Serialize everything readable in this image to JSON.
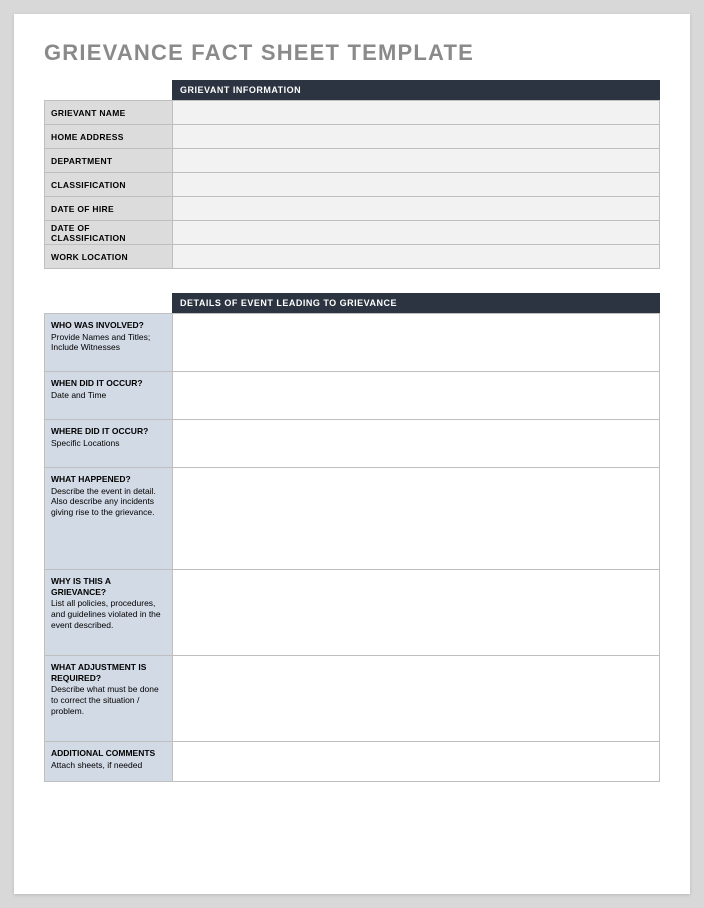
{
  "title": "GRIEVANCE FACT SHEET TEMPLATE",
  "section1": {
    "header": "GRIEVANT INFORMATION",
    "rows": [
      {
        "label": "GRIEVANT NAME",
        "value": ""
      },
      {
        "label": "HOME ADDRESS",
        "value": ""
      },
      {
        "label": "DEPARTMENT",
        "value": ""
      },
      {
        "label": "CLASSIFICATION",
        "value": ""
      },
      {
        "label": "DATE OF HIRE",
        "value": ""
      },
      {
        "label": "DATE OF CLASSIFICATION",
        "value": ""
      },
      {
        "label": "WORK LOCATION",
        "value": ""
      }
    ]
  },
  "section2": {
    "header": "DETAILS OF EVENT LEADING TO GRIEVANCE",
    "rows": [
      {
        "q": "WHO WAS INVOLVED?",
        "sub": "Provide Names and Titles; Include Witnesses",
        "size": "h-who",
        "value": ""
      },
      {
        "q": "WHEN DID IT OCCUR?",
        "sub": "Date and Time",
        "size": "h-sm",
        "value": ""
      },
      {
        "q": "WHERE DID IT OCCUR?",
        "sub": "Specific Locations",
        "size": "h-sm",
        "value": ""
      },
      {
        "q": "WHAT HAPPENED?",
        "sub": "Describe the event in detail.  Also describe any incidents giving rise to the grievance.",
        "size": "h-lg",
        "value": ""
      },
      {
        "q": "WHY IS THIS A GRIEVANCE?",
        "sub": "List all policies, procedures, and guidelines violated in the event described.",
        "size": "h-med",
        "value": ""
      },
      {
        "q": "WHAT ADJUSTMENT IS REQUIRED?",
        "sub": "Describe what must be done to correct the situation / problem.",
        "size": "h-med",
        "value": ""
      },
      {
        "q": "ADDITIONAL COMMENTS",
        "sub": "Attach sheets, if needed",
        "size": "h-add",
        "value": ""
      }
    ]
  }
}
